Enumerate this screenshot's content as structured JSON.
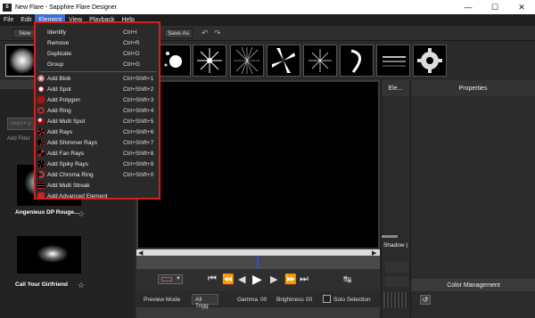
{
  "window": {
    "title": "New Flare - Sapphire Flare Designer",
    "app_icon": "S"
  },
  "menubar": [
    "File",
    "Edit",
    "Element",
    "View",
    "Playback",
    "Help"
  ],
  "toolbar": {
    "new_label": "New",
    "save_as_label": "Save As"
  },
  "element_menu": {
    "group1": [
      {
        "label": "Identify",
        "shortcut": "Ctrl+I"
      },
      {
        "label": "Remove",
        "shortcut": "Ctrl+R"
      },
      {
        "label": "Duplicate",
        "shortcut": "Ctrl+D"
      },
      {
        "label": "Group",
        "shortcut": "Ctrl+G"
      }
    ],
    "group2": [
      {
        "label": "Add Blob",
        "shortcut": "Ctrl+Shift+1",
        "icon": "blob-icon"
      },
      {
        "label": "Add Spot",
        "shortcut": "Ctrl+Shift+2",
        "icon": "spot-icon"
      },
      {
        "label": "Add Polygon",
        "shortcut": "Ctrl+Shift+3",
        "icon": "polygon-icon"
      },
      {
        "label": "Add Ring",
        "shortcut": "Ctrl+Shift+4",
        "icon": "ring-icon"
      },
      {
        "label": "Add Multi Spot",
        "shortcut": "Ctrl+Shift+5",
        "icon": "multi-spot-icon"
      },
      {
        "label": "Add Rays",
        "shortcut": "Ctrl+Shift+6",
        "icon": "rays-icon"
      },
      {
        "label": "Add Shimmer Rays",
        "shortcut": "Ctrl+Shift+7",
        "icon": "shimmer-rays-icon"
      },
      {
        "label": "Add Fan Rays",
        "shortcut": "Ctrl+Shift+8",
        "icon": "fan-rays-icon"
      },
      {
        "label": "Add Spiky Rays",
        "shortcut": "Ctrl+Shift+9",
        "icon": "spiky-rays-icon"
      },
      {
        "label": "Add Chroma Ring",
        "shortcut": "Ctrl+Shift+0",
        "icon": "chroma-ring-icon"
      },
      {
        "label": "Add Multi Streak",
        "shortcut": "",
        "icon": "multi-streak-icon"
      },
      {
        "label": "Add Advanced Element",
        "shortcut": "",
        "icon": "advanced-element-icon"
      }
    ]
  },
  "left_panel": {
    "search_placeholder": "Search p",
    "add_filter": "Add Filter",
    "presets": [
      {
        "name": "Angenieux DP Rouge..."
      },
      {
        "name": "Call Your Girlfriend"
      }
    ]
  },
  "element_panel": {
    "title": "Ele...",
    "shadow_label": "Shadow ("
  },
  "properties_panel": {
    "title": "Properties",
    "color_management": "Color Management"
  },
  "bottom_bar": {
    "preview_mode_label": "Preview Mode",
    "preview_mode_value": "All Trigg",
    "gamma_label": "Gamma",
    "gamma_value": "00",
    "brightness_label": "Brightness",
    "brightness_value": "00",
    "solo_selection_label": "Solo Selection"
  },
  "colors": {
    "menu_highlight": "#3e6fd0",
    "annotation_border": "#d42020",
    "playhead": "#3050d0"
  }
}
